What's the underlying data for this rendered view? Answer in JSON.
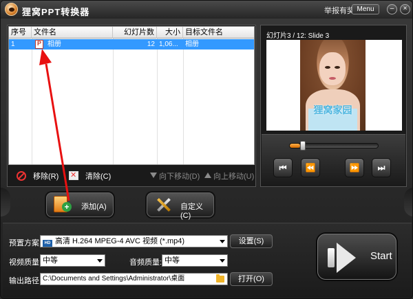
{
  "window": {
    "title": "狸窝PPT转换器",
    "report_link": "举报有奖",
    "menu_label": "Menu",
    "minimize_glyph": "–",
    "close_glyph": "×"
  },
  "file_list": {
    "columns": [
      "序号",
      "文件名",
      "幻灯片数",
      "大小",
      "目标文件名"
    ],
    "rows": [
      {
        "index": "1",
        "name": "相册",
        "slides": "12",
        "size": "1,06...",
        "target": "相册",
        "selected": true
      }
    ]
  },
  "list_toolbar": {
    "remove_label": "移除(R)",
    "clear_label": "清除(C)",
    "move_down_label": "向下移动(D)",
    "move_up_label": "向上移动(U)"
  },
  "preview": {
    "slide_label": "幻灯片3 / 12: Slide 3",
    "watermark": "狸窝家园",
    "seek_fraction": 0.12
  },
  "player_controls": {
    "first_glyph": "⏮",
    "prev_glyph": "⏪",
    "next_glyph": "⏩",
    "last_glyph": "⏭"
  },
  "actions": {
    "add_label": "添加(A)",
    "customize_label": "自定义(C)"
  },
  "settings": {
    "preset_label": "预置方案:",
    "preset_value": "高清 H.264 MPEG-4 AVC 视频 (*.mp4)",
    "preset_badge": "HD",
    "settings_button": "设置(S)",
    "video_quality_label": "视频质量:",
    "video_quality_value": "中等",
    "audio_quality_label": "音频质量:",
    "audio_quality_value": "中等",
    "output_path_label": "输出路径:",
    "output_path_value": "C:\\Documents and Settings\\Administrator\\桌面",
    "open_button": "打开(O)",
    "start_label": "Start"
  },
  "colors": {
    "selection": "#3399ff",
    "annotation_arrow": "#e81010",
    "seek_fill": "#f08a1c"
  },
  "icons": [
    "app-logo-icon",
    "ppt-file-icon",
    "remove-icon",
    "clear-icon",
    "down-arrow-icon",
    "up-arrow-icon",
    "add-file-icon",
    "tools-icon",
    "hd-video-icon",
    "folder-icon",
    "start-arrow-icon"
  ]
}
